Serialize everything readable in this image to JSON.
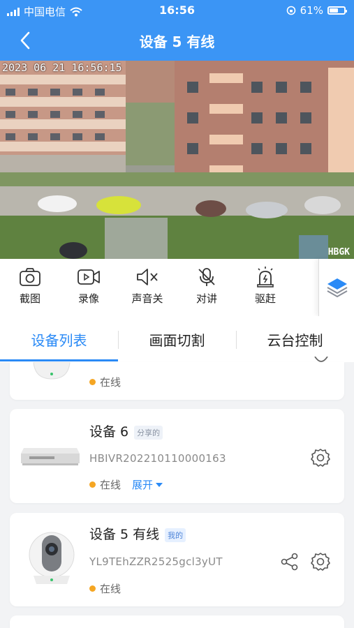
{
  "status_bar": {
    "carrier": "中国电信",
    "time": "16:56",
    "battery": "61%",
    "battery_level": 0.61
  },
  "navbar": {
    "title": "设备 5 有线"
  },
  "video": {
    "timestamp": "2023 06 21 16:56:15",
    "watermark": "HBGK"
  },
  "toolbar": {
    "items": [
      {
        "label": "截图",
        "icon": "camera-icon"
      },
      {
        "label": "录像",
        "icon": "video-record-icon"
      },
      {
        "label": "声音关",
        "icon": "speaker-mute-icon"
      },
      {
        "label": "对讲",
        "icon": "mic-off-icon"
      },
      {
        "label": "驱赶",
        "icon": "alarm-light-icon"
      }
    ],
    "layer_icon": "layers-icon"
  },
  "tabs": [
    {
      "label": "设备列表",
      "active": true
    },
    {
      "label": "画面切割",
      "active": false
    },
    {
      "label": "云台控制",
      "active": false
    }
  ],
  "devices": [
    {
      "status": "在线"
    },
    {
      "name": "设备 6",
      "tag": "分享的",
      "serial": "HBIVR202210110000163",
      "status": "在线",
      "expand": "展开"
    },
    {
      "name": "设备 5 有线",
      "tag": "我的",
      "serial": "YL9TEhZZR2525gcl3yUT",
      "status": "在线"
    }
  ],
  "colors": {
    "primary": "#3b95f5",
    "accent": "#2a8af6",
    "online": "#f5a623"
  }
}
